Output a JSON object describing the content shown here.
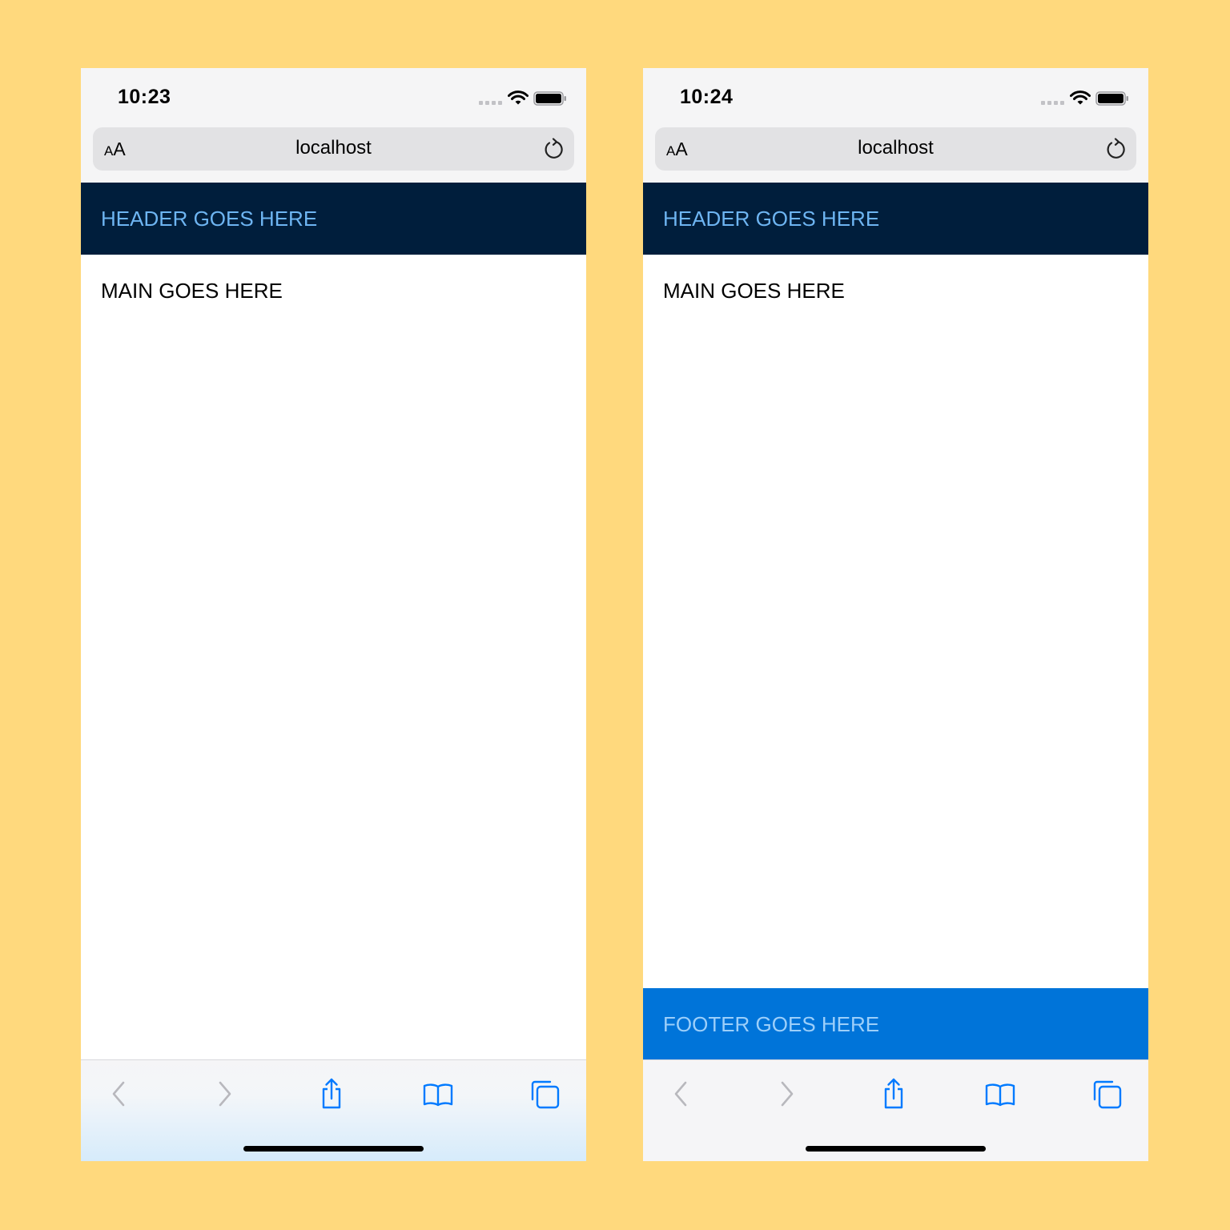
{
  "colors": {
    "page_background": "#FFD97D",
    "header_background": "#001E3C",
    "header_text": "#6EB5F2",
    "footer_background": "#0074D9",
    "footer_text": "#9CCFFA",
    "ios_blue": "#007AFF"
  },
  "phones": [
    {
      "status": {
        "time": "10:23"
      },
      "browser": {
        "text_size_small": "A",
        "text_size_large": "A",
        "url": "localhost"
      },
      "page": {
        "header": "HEADER GOES HERE",
        "main": "MAIN GOES HERE"
      },
      "toolbar_icons": [
        "back-chevron-icon",
        "forward-chevron-icon",
        "share-icon",
        "bookmarks-book-icon",
        "tabs-icon"
      ]
    },
    {
      "status": {
        "time": "10:24"
      },
      "browser": {
        "text_size_small": "A",
        "text_size_large": "A",
        "url": "localhost"
      },
      "page": {
        "header": "HEADER GOES HERE",
        "main": "MAIN GOES HERE",
        "footer": "FOOTER GOES HERE"
      },
      "toolbar_icons": [
        "back-chevron-icon",
        "forward-chevron-icon",
        "share-icon",
        "bookmarks-book-icon",
        "tabs-icon"
      ]
    }
  ]
}
